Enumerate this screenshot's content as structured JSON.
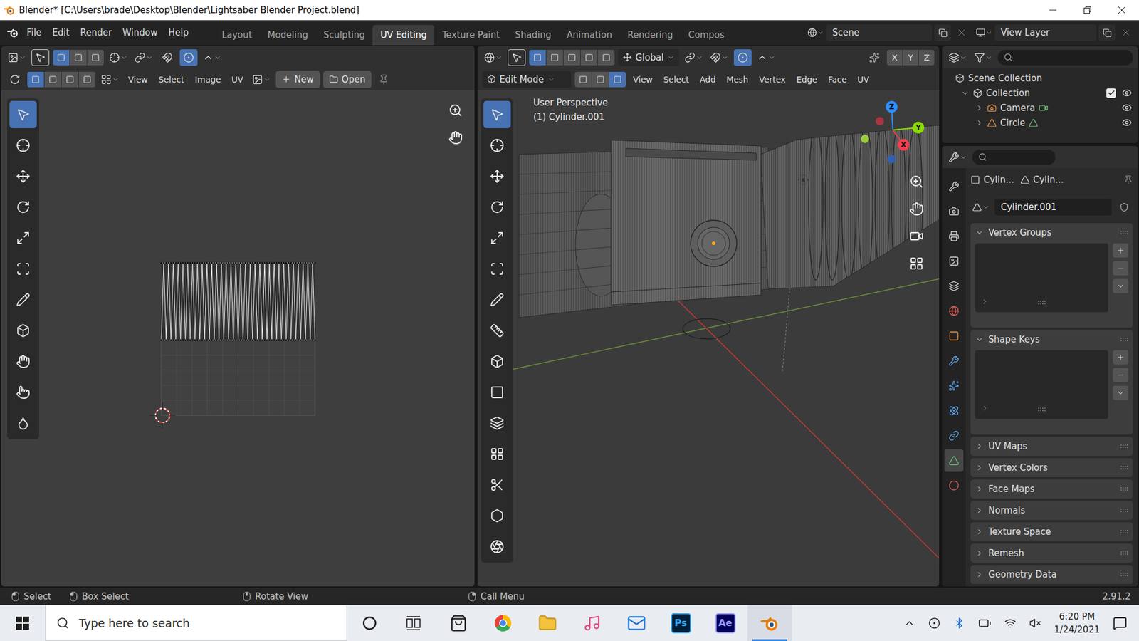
{
  "window": {
    "title": "Blender* [C:\\Users\\brade\\Desktop\\Blender\\Lightsaber Blender Project.blend]"
  },
  "menu": [
    "File",
    "Edit",
    "Render",
    "Window",
    "Help"
  ],
  "workspaces": [
    {
      "label": "Layout",
      "selected": false
    },
    {
      "label": "Modeling",
      "selected": false
    },
    {
      "label": "Sculpting",
      "selected": false
    },
    {
      "label": "UV Editing",
      "selected": true
    },
    {
      "label": "Texture Paint",
      "selected": false
    },
    {
      "label": "Shading",
      "selected": false
    },
    {
      "label": "Animation",
      "selected": false
    },
    {
      "label": "Rendering",
      "selected": false
    },
    {
      "label": "Compos",
      "selected": false
    }
  ],
  "scene": "Scene",
  "view_layer": "View Layer",
  "uv_editor": {
    "box_modes": [
      {
        "selected": true
      },
      {
        "selected": false
      },
      {
        "selected": false
      }
    ],
    "proportional_editing": true,
    "select_modes": [
      {
        "selected": true
      },
      {
        "selected": false
      },
      {
        "selected": false
      },
      {
        "selected": false
      }
    ],
    "menus": [
      "View",
      "Select",
      "Image",
      "UV"
    ],
    "new_button": "New",
    "open_button": "Open",
    "tools": [
      {
        "selected": true
      },
      {
        "selected": false
      },
      {
        "selected": false
      },
      {
        "selected": false
      },
      {
        "selected": false
      },
      {
        "selected": false
      },
      {
        "selected": false
      },
      {
        "selected": false
      },
      {
        "selected": false
      },
      {
        "selected": false
      },
      {
        "selected": false
      }
    ]
  },
  "viewport": {
    "box_modes": [
      {
        "selected": true
      },
      {
        "selected": false
      },
      {
        "selected": false
      },
      {
        "selected": false
      },
      {
        "selected": false
      }
    ],
    "orientation": "Global",
    "proportional_editing": true,
    "mirror_axes": [
      {
        "label": "X",
        "on": false
      },
      {
        "label": "Y",
        "on": false
      },
      {
        "label": "Z",
        "on": false
      }
    ],
    "mode": "Edit Mode",
    "select_modes": [
      {
        "selected": false
      },
      {
        "selected": false
      },
      {
        "selected": true
      }
    ],
    "menus": [
      "View",
      "Select",
      "Add",
      "Mesh",
      "Vertex",
      "Edge",
      "Face",
      "UV"
    ],
    "overlay_lines": [
      "User Perspective",
      "(1) Cylinder.001"
    ],
    "gizmo_axes": [
      "X",
      "Y",
      "Z"
    ],
    "tools": [
      {
        "selected": true
      },
      {
        "selected": false
      },
      {
        "selected": false
      },
      {
        "selected": false
      },
      {
        "selected": false
      },
      {
        "selected": false
      },
      {
        "selected": false
      },
      {
        "selected": false
      },
      {
        "selected": false
      },
      {
        "selected": false
      },
      {
        "selected": false
      },
      {
        "selected": false
      },
      {
        "selected": false
      },
      {
        "selected": false
      },
      {
        "selected": false
      }
    ]
  },
  "outliner": {
    "root": "Scene Collection",
    "items": [
      {
        "label": "Collection",
        "kind": "collection",
        "expanded": true,
        "checked": true,
        "visible": true
      },
      {
        "label": "Camera",
        "kind": "camera",
        "expanded": false,
        "visible": true
      },
      {
        "label": "Circle",
        "kind": "mesh",
        "expanded": false,
        "visible": true
      }
    ]
  },
  "properties": {
    "tabs": [
      {
        "selected": false
      },
      {
        "selected": false
      },
      {
        "selected": false
      },
      {
        "selected": false
      },
      {
        "selected": false
      },
      {
        "selected": false
      },
      {
        "selected": false
      },
      {
        "selected": false
      },
      {
        "selected": false
      },
      {
        "selected": false
      },
      {
        "selected": false
      },
      {
        "selected": true
      },
      {
        "selected": false
      }
    ],
    "context": [
      "Cylin...",
      "Cylin..."
    ],
    "mesh_name": "Cylinder.001",
    "panels": [
      {
        "label": "Vertex Groups",
        "expanded": true
      },
      {
        "label": "Shape Keys",
        "expanded": true
      },
      {
        "label": "UV Maps",
        "expanded": false
      },
      {
        "label": "Vertex Colors",
        "expanded": false
      },
      {
        "label": "Face Maps",
        "expanded": false
      },
      {
        "label": "Normals",
        "expanded": false
      },
      {
        "label": "Texture Space",
        "expanded": false
      },
      {
        "label": "Remesh",
        "expanded": false
      },
      {
        "label": "Geometry Data",
        "expanded": false
      }
    ]
  },
  "status_bar": {
    "items": [
      "Select",
      "Box Select",
      "Rotate View",
      "Call Menu"
    ],
    "version": "2.91.2"
  },
  "taskbar": {
    "search_placeholder": "Type here to search",
    "apps": [
      {
        "kind": "cortana",
        "active": false
      },
      {
        "kind": "task-view",
        "active": false
      },
      {
        "kind": "store",
        "active": false
      },
      {
        "kind": "chrome",
        "active": false
      },
      {
        "kind": "explorer",
        "active": false
      },
      {
        "kind": "itunes",
        "active": false
      },
      {
        "kind": "mail",
        "active": false
      },
      {
        "kind": "photoshop",
        "label": "Ps",
        "active": false
      },
      {
        "kind": "after-effects",
        "label": "Ae",
        "active": false
      },
      {
        "kind": "blender",
        "active": true
      }
    ],
    "time": "6:20 PM",
    "date": "1/24/2021"
  }
}
